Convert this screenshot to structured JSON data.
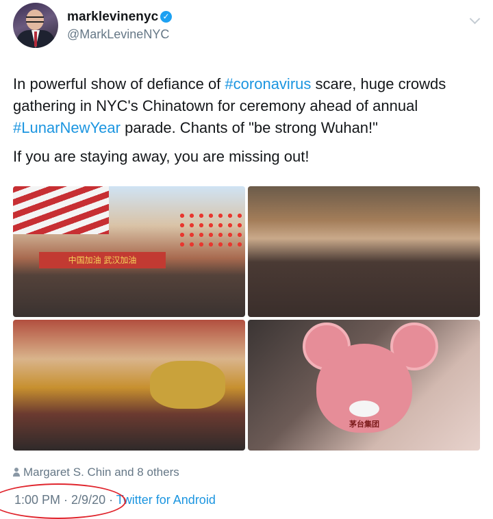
{
  "header": {
    "display_name": "marklevinenyc",
    "handle": "@MarkLevineNYC",
    "verified_icon": "verified-check-icon",
    "menu_icon": "chevron-down-icon"
  },
  "tweet": {
    "line1_before": "In powerful show of defiance of ",
    "hashtag1": "#coronavirus",
    "line1_after": " scare, huge crowds gathering in NYC's Chinatown for ceremony ahead of annual ",
    "hashtag2": "#LunarNewYear",
    "line1_end": " parade. Chants of \"be strong Wuhan!\"",
    "line2": "If you are staying away, you are missing out!"
  },
  "photos": [
    {
      "alt": "Street with American flag, red banners and crowd"
    },
    {
      "alt": "Crowd under awning with people in red sashes"
    },
    {
      "alt": "Golden dragon and red lanterns over crowd"
    },
    {
      "alt": "Pink mouse plush toy held in hand"
    }
  ],
  "banner_text": "中国加油 武汉加油",
  "plush_text": "茅台集团",
  "footer": {
    "likes_icon": "person-icon",
    "likes_text": "Margaret S. Chin and 8 others",
    "time": "1:00 PM",
    "separator": " · ",
    "date": "2/9/20",
    "client": "Twitter for Android"
  },
  "colors": {
    "accent": "#1b95e0",
    "verified": "#1da1f2",
    "annotation_circle": "#e0252d"
  }
}
